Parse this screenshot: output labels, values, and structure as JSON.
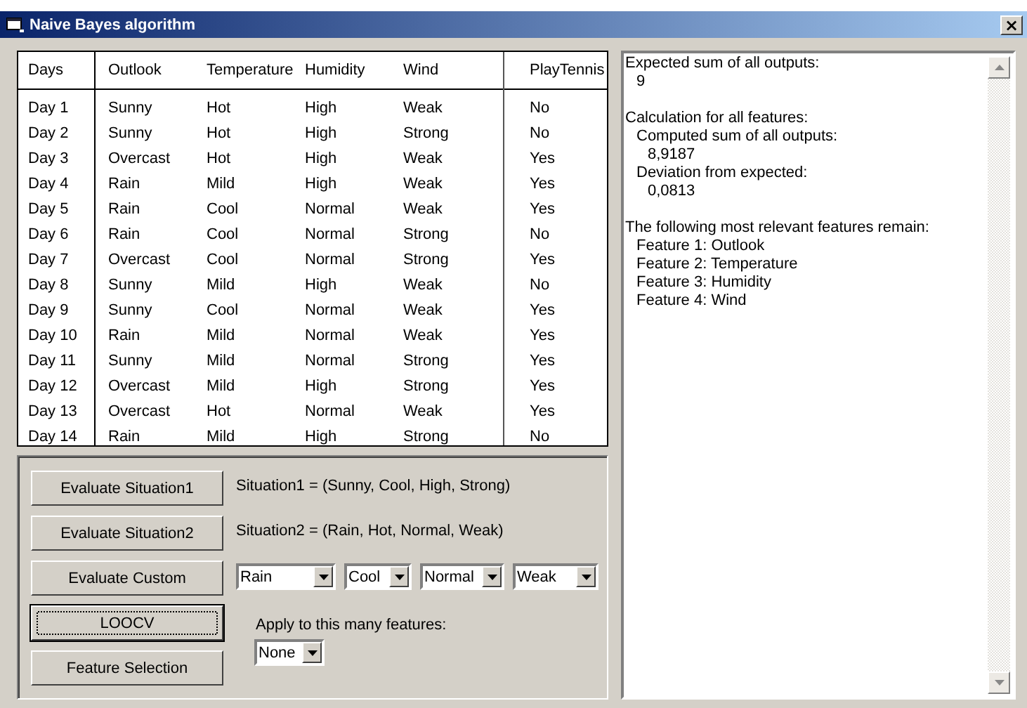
{
  "window": {
    "title": "Naive Bayes algorithm",
    "close": "×"
  },
  "table": {
    "columns": [
      "Days",
      "Outlook",
      "Temperature",
      "Humidity",
      "Wind",
      "PlayTennis"
    ],
    "rows": [
      [
        "Day 1",
        "Sunny",
        "Hot",
        "High",
        "Weak",
        "No"
      ],
      [
        "Day 2",
        "Sunny",
        "Hot",
        "High",
        "Strong",
        "No"
      ],
      [
        "Day 3",
        "Overcast",
        "Hot",
        "High",
        "Weak",
        "Yes"
      ],
      [
        "Day 4",
        "Rain",
        "Mild",
        "High",
        "Weak",
        "Yes"
      ],
      [
        "Day 5",
        "Rain",
        "Cool",
        "Normal",
        "Weak",
        "Yes"
      ],
      [
        "Day 6",
        "Rain",
        "Cool",
        "Normal",
        "Strong",
        "No"
      ],
      [
        "Day 7",
        "Overcast",
        "Cool",
        "Normal",
        "Strong",
        "Yes"
      ],
      [
        "Day 8",
        "Sunny",
        "Mild",
        "High",
        "Weak",
        "No"
      ],
      [
        "Day 9",
        "Sunny",
        "Cool",
        "Normal",
        "Weak",
        "Yes"
      ],
      [
        "Day 10",
        "Rain",
        "Mild",
        "Normal",
        "Weak",
        "Yes"
      ],
      [
        "Day 11",
        "Sunny",
        "Mild",
        "Normal",
        "Strong",
        "Yes"
      ],
      [
        "Day 12",
        "Overcast",
        "Mild",
        "High",
        "Strong",
        "Yes"
      ],
      [
        "Day 13",
        "Overcast",
        "Hot",
        "Normal",
        "Weak",
        "Yes"
      ],
      [
        "Day 14",
        "Rain",
        "Mild",
        "High",
        "Strong",
        "No"
      ]
    ]
  },
  "controls": [
    {
      "kind": "labeled",
      "button": "Evaluate Situation1",
      "focused": false,
      "label": "Situation1 = (Sunny, Cool, High, Strong)"
    },
    {
      "kind": "labeled",
      "button": "Evaluate Situation2",
      "focused": false,
      "label": "Situation2 = (Rain, Hot, Normal, Weak)"
    },
    {
      "kind": "dropdowns",
      "button": "Evaluate Custom",
      "focused": false,
      "dropdowns": [
        "Rain",
        "Cool",
        "Normal",
        "Weak"
      ]
    },
    {
      "kind": "plain",
      "button": "LOOCV",
      "focused": true
    },
    {
      "kind": "plain",
      "button": "Feature Selection",
      "focused": false
    }
  ],
  "feature_count": {
    "label": "Apply to this many features:",
    "value": "None"
  },
  "output": [
    {
      "text": "Expected sum of all outputs:",
      "children": [
        {
          "text": "9"
        }
      ]
    },
    {
      "text": "Calculation for all features:",
      "children": [
        {
          "text": "Computed sum of all outputs:",
          "children": [
            {
              "text": "8,9187"
            }
          ]
        },
        {
          "text": "Deviation from expected:",
          "children": [
            {
              "text": "0,0813"
            }
          ]
        }
      ]
    },
    {
      "text": "The following most relevant features remain:",
      "children": [
        {
          "text": "Feature 1: Outlook"
        },
        {
          "text": "Feature 2: Temperature"
        },
        {
          "text": "Feature 3: Humidity"
        },
        {
          "text": "Feature 4: Wind"
        }
      ]
    }
  ]
}
